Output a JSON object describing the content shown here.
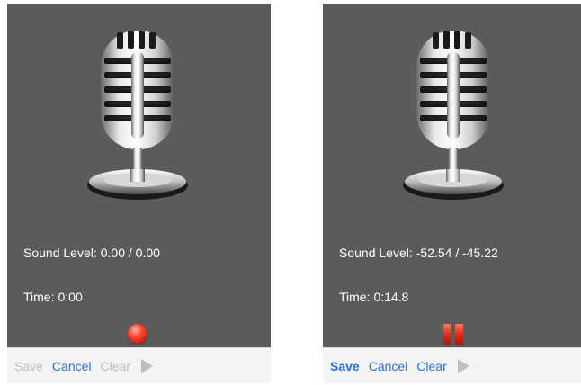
{
  "colors": {
    "background": "#5b5b5b",
    "text": "#ffffff",
    "accent": "#2a6fe0",
    "disabled": "#bdbdbd",
    "record": "#e0301c"
  },
  "panels": [
    {
      "state": "idle",
      "sound_level_label": "Sound Level:",
      "sound_level_value": "0.00 / 0.00",
      "time_label": "Time:",
      "time_value": "0:00",
      "control_icon": "record-icon",
      "toolbar": {
        "save": "Save",
        "save_enabled": false,
        "cancel": "Cancel",
        "cancel_enabled": true,
        "clear": "Clear",
        "clear_enabled": false,
        "play_icon": "play-icon",
        "play_enabled": false
      }
    },
    {
      "state": "recording",
      "sound_level_label": "Sound Level:",
      "sound_level_value": "-52.54 / -45.22",
      "time_label": "Time:",
      "time_value": "0:14.8",
      "control_icon": "pause-icon",
      "toolbar": {
        "save": "Save",
        "save_enabled": true,
        "cancel": "Cancel",
        "cancel_enabled": true,
        "clear": "Clear",
        "clear_enabled": true,
        "play_icon": "play-icon",
        "play_enabled": false
      }
    }
  ]
}
